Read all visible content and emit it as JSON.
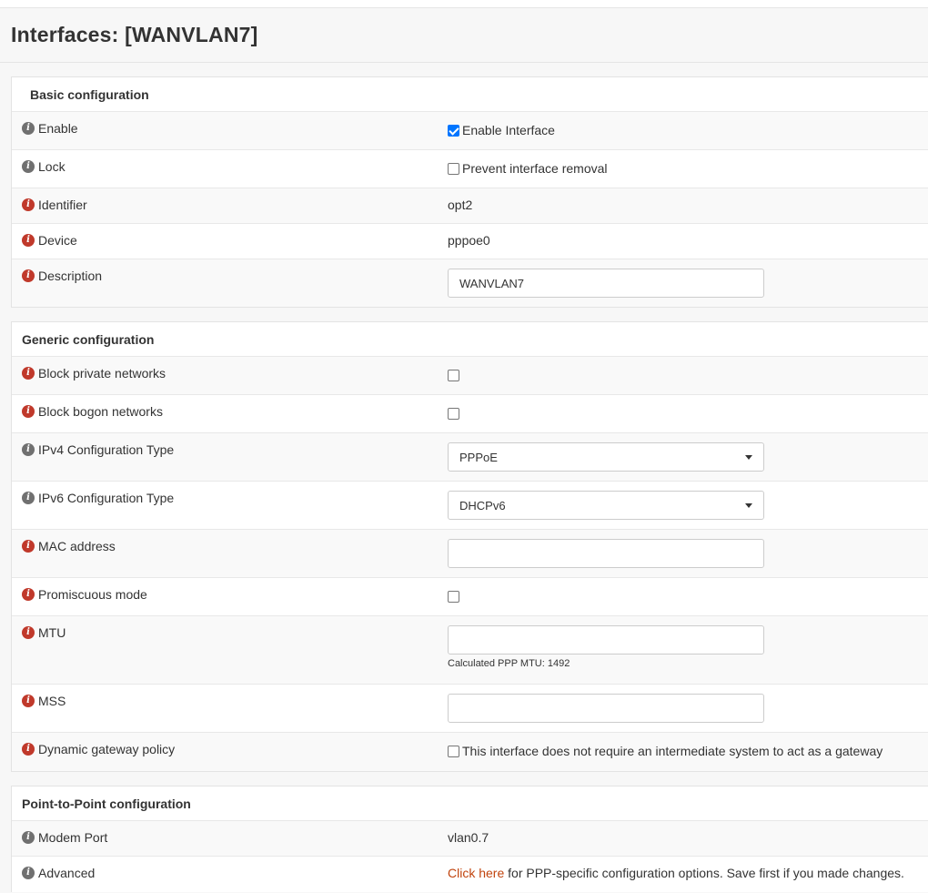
{
  "page": {
    "title": "Interfaces: [WANVLAN7]"
  },
  "basic": {
    "title": "Basic configuration",
    "enable": {
      "label": "Enable",
      "checkbox_label": "Enable Interface",
      "checked": true
    },
    "lock": {
      "label": "Lock",
      "checkbox_label": "Prevent interface removal",
      "checked": false
    },
    "identifier": {
      "label": "Identifier",
      "value": "opt2"
    },
    "device": {
      "label": "Device",
      "value": "pppoe0"
    },
    "description": {
      "label": "Description",
      "value": "WANVLAN7"
    }
  },
  "generic": {
    "title": "Generic configuration",
    "block_private": {
      "label": "Block private networks",
      "checked": false
    },
    "block_bogon": {
      "label": "Block bogon networks",
      "checked": false
    },
    "ipv4_type": {
      "label": "IPv4 Configuration Type",
      "value": "PPPoE"
    },
    "ipv6_type": {
      "label": "IPv6 Configuration Type",
      "value": "DHCPv6"
    },
    "mac": {
      "label": "MAC address",
      "value": ""
    },
    "promisc": {
      "label": "Promiscuous mode",
      "checked": false
    },
    "mtu": {
      "label": "MTU",
      "value": "",
      "help": "Calculated PPP MTU: 1492"
    },
    "mss": {
      "label": "MSS",
      "value": ""
    },
    "gateway_policy": {
      "label": "Dynamic gateway policy",
      "checkbox_label": "This interface does not require an intermediate system to act as a gateway",
      "checked": false
    }
  },
  "ptp": {
    "title": "Point-to-Point configuration",
    "modem_port": {
      "label": "Modem Port",
      "value": "vlan0.7"
    },
    "advanced": {
      "label": "Advanced",
      "link_text": "Click here",
      "text": " for PPP-specific configuration options. Save first if you made changes."
    }
  },
  "colors": {
    "info_gray": "#707070",
    "info_red": "#c0392b",
    "link": "#c1440e",
    "checkbox_checked": "#0075ff"
  },
  "icons": {
    "info": "info-circle-icon",
    "dropdown": "caret-down-icon"
  }
}
